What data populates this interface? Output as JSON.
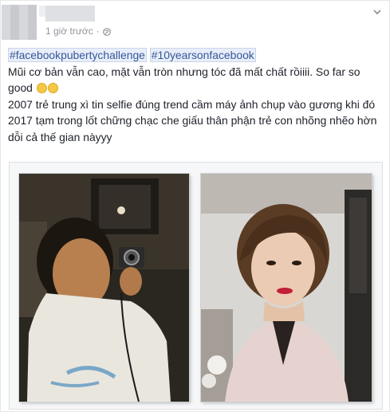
{
  "post": {
    "timestamp": "1 giờ trước",
    "hashtag_1": "#facebookpubertychallenge",
    "hashtag_2": "#10yearsonfacebook",
    "line_1a": "Mũi cơ bản vẫn cao, mặt vẫn tròn nhưng tóc đã mất chất rồiiii. So far so",
    "line_1b": "good",
    "line_2": "2007 trẻ trung xì tin selfie đúng trend cầm máy ảnh chụp vào gương khi đó",
    "line_3": "2017 tạm trong lốt chững chạc che giấu thân phận trẻ con nhõng nhẽo hờn dỗi cả thế gian nàyyy"
  },
  "photos": [
    {
      "name": "photo-2007-mirror-selfie"
    },
    {
      "name": "photo-2017-portrait"
    }
  ],
  "icons": {
    "privacy": "globe-icon",
    "menu": "chevron-down-icon",
    "emoji": "smiley-emoji-icon"
  },
  "colors": {
    "text": "#1d2129",
    "meta": "#90949c",
    "link": "#365899"
  }
}
